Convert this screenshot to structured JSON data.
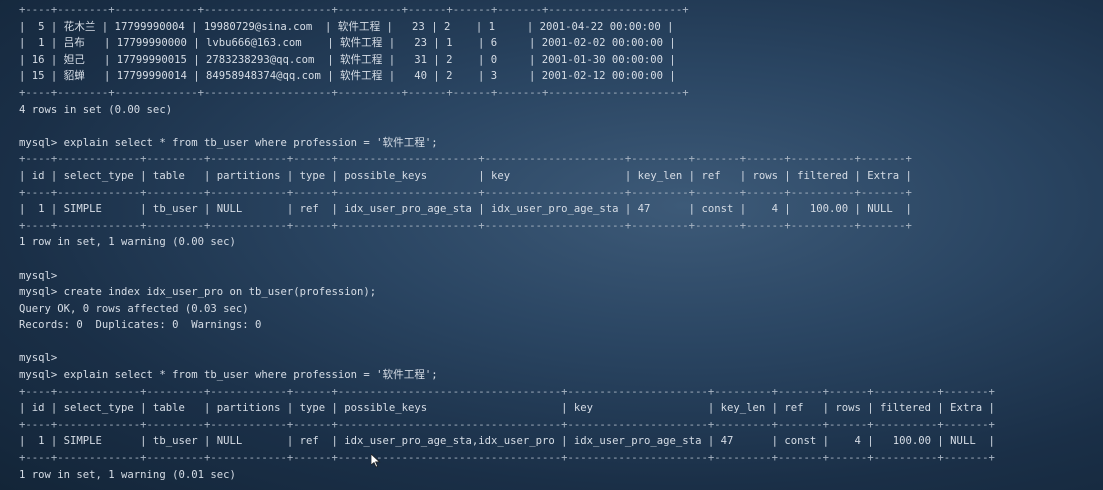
{
  "terminal": {
    "lines": [
      "+----+--------+-------------+--------------------+----------+------+------+-------+---------------------+",
      "|  5 | 花木兰 | 17799990004 | 19980729@sina.com  | 软件工程 |   23 | 2    | 1     | 2001-04-22 00:00:00 |",
      "|  1 | 吕布   | 17799990000 | lvbu666@163.com    | 软件工程 |   23 | 1    | 6     | 2001-02-02 00:00:00 |",
      "| 16 | 妲己   | 17799990015 | 2783238293@qq.com  | 软件工程 |   31 | 2    | 0     | 2001-01-30 00:00:00 |",
      "| 15 | 貂蝉   | 17799990014 | 84958948374@qq.com | 软件工程 |   40 | 2    | 3     | 2001-02-12 00:00:00 |",
      "+----+--------+-------------+--------------------+----------+------+------+-------+---------------------+",
      "4 rows in set (0.00 sec)",
      "",
      "mysql> explain select * from tb_user where profession = '软件工程';",
      "+----+-------------+---------+------------+------+----------------------+----------------------+---------+-------+------+----------+-------+",
      "| id | select_type | table   | partitions | type | possible_keys        | key                  | key_len | ref   | rows | filtered | Extra |",
      "+----+-------------+---------+------------+------+----------------------+----------------------+---------+-------+------+----------+-------+",
      "|  1 | SIMPLE      | tb_user | NULL       | ref  | idx_user_pro_age_sta | idx_user_pro_age_sta | 47      | const |    4 |   100.00 | NULL  |",
      "+----+-------------+---------+------------+------+----------------------+----------------------+---------+-------+------+----------+-------+",
      "1 row in set, 1 warning (0.00 sec)",
      "",
      "mysql>",
      "mysql> create index idx_user_pro on tb_user(profession);",
      "Query OK, 0 rows affected (0.03 sec)",
      "Records: 0  Duplicates: 0  Warnings: 0",
      "",
      "mysql>",
      "mysql> explain select * from tb_user where profession = '软件工程';",
      "+----+-------------+---------+------------+------+-----------------------------------+----------------------+---------+-------+------+----------+-------+",
      "| id | select_type | table   | partitions | type | possible_keys                     | key                  | key_len | ref   | rows | filtered | Extra |",
      "+----+-------------+---------+------------+------+-----------------------------------+----------------------+---------+-------+------+----------+-------+",
      "|  1 | SIMPLE      | tb_user | NULL       | ref  | idx_user_pro_age_sta,idx_user_pro | idx_user_pro_age_sta | 47      | const |    4 |   100.00 | NULL  |",
      "+----+-------------+---------+------------+------+-----------------------------------+----------------------+---------+-------+------+----------+-------+",
      "1 row in set, 1 warning (0.01 sec)"
    ]
  }
}
